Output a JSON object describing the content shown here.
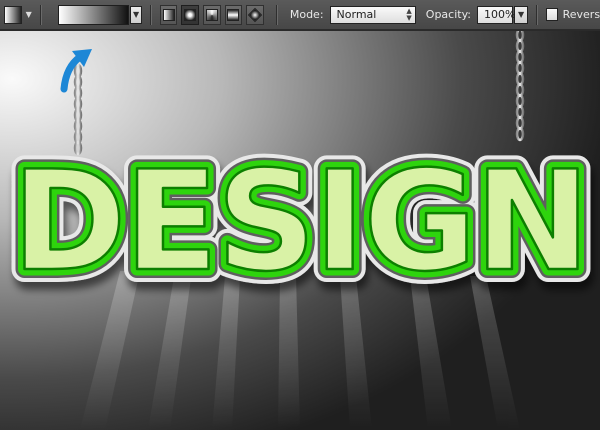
{
  "toolbar": {
    "mode_label": "Mode:",
    "mode_value": "Normal",
    "opacity_label": "Opacity:",
    "opacity_value": "100%",
    "reverse_label": "Revers"
  },
  "canvas": {
    "text": "DESIGN",
    "text_color": "#2fd40f",
    "fill_color": "#d9f2a6",
    "outline_color": "#e8e8e8"
  },
  "icons": [
    "gradient-tool-icon",
    "linear-gradient-icon",
    "radial-gradient-icon",
    "angle-gradient-icon",
    "reflected-gradient-icon",
    "diamond-gradient-icon",
    "blue-arrow-icon",
    "chain-icon"
  ]
}
